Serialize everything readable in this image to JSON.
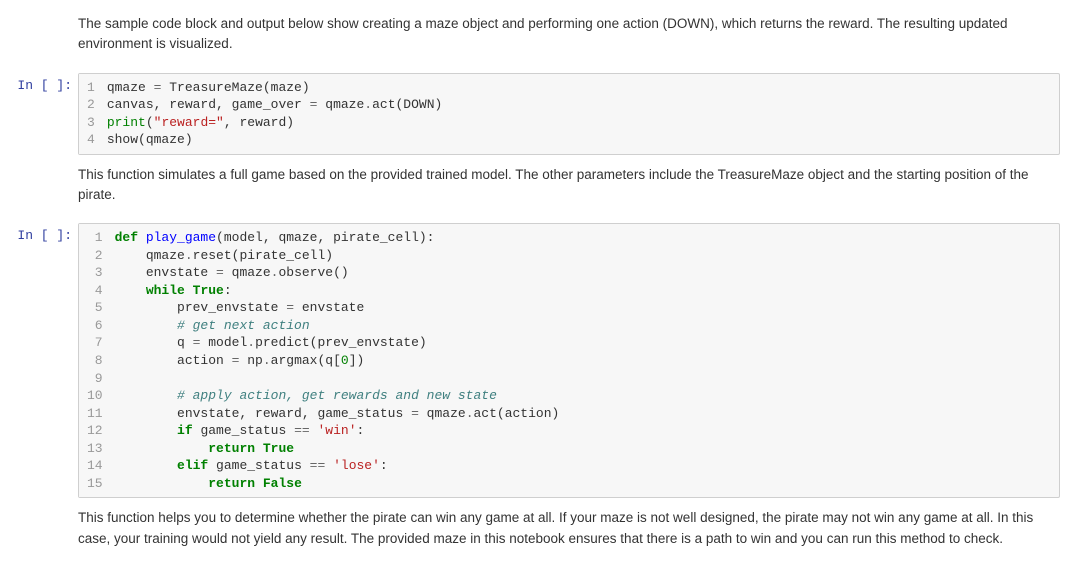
{
  "cells": {
    "md1": "The sample code block and output below show creating a maze object and performing one action (DOWN), which returns the reward. The resulting updated environment is visualized.",
    "md2": "This function simulates a full game based on the provided trained model. The other parameters include the TreasureMaze object and the starting position of the pirate.",
    "md3": "This function helps you to determine whether the pirate can win any game at all. If your maze is not well designed, the pirate may not win any game at all. In this case, your training would not yield any result. The provided maze in this notebook ensures that there is a path to win and you can run this method to check."
  },
  "prompts": {
    "in_empty": "In [ ]:"
  },
  "code1": {
    "l1a": "qmaze ",
    "l1b": "=",
    "l1c": " TreasureMaze(maze)",
    "l2a": "canvas, reward, game_over ",
    "l2b": "=",
    "l2c": " qmaze",
    "l2d": ".",
    "l2e": "act(DOWN)",
    "l3a": "print",
    "l3b": "(",
    "l3c": "\"reward=\"",
    "l3d": ", reward)",
    "l4a": "show(qmaze)"
  },
  "code2": {
    "l1a": "def",
    "l1b": " ",
    "l1c": "play_game",
    "l1d": "(model, qmaze, pirate_cell):",
    "l2a": "    qmaze",
    "l2b": ".",
    "l2c": "reset(pirate_cell)",
    "l3a": "    envstate ",
    "l3b": "=",
    "l3c": " qmaze",
    "l3d": ".",
    "l3e": "observe()",
    "l4a": "    ",
    "l4b": "while",
    "l4c": " ",
    "l4d": "True",
    "l4e": ":",
    "l5a": "        prev_envstate ",
    "l5b": "=",
    "l5c": " envstate",
    "l6a": "        ",
    "l6b": "# get next action",
    "l7a": "        q ",
    "l7b": "=",
    "l7c": " model",
    "l7d": ".",
    "l7e": "predict(prev_envstate)",
    "l8a": "        action ",
    "l8b": "=",
    "l8c": " np",
    "l8d": ".",
    "l8e": "argmax(q[",
    "l8f": "0",
    "l8g": "])",
    "l10a": "        ",
    "l10b": "# apply action, get rewards and new state",
    "l11a": "        envstate, reward, game_status ",
    "l11b": "=",
    "l11c": " qmaze",
    "l11d": ".",
    "l11e": "act(action)",
    "l12a": "        ",
    "l12b": "if",
    "l12c": " game_status ",
    "l12d": "==",
    "l12e": " ",
    "l12f": "'win'",
    "l12g": ":",
    "l13a": "            ",
    "l13b": "return",
    "l13c": " ",
    "l13d": "True",
    "l14a": "        ",
    "l14b": "elif",
    "l14c": " game_status ",
    "l14d": "==",
    "l14e": " ",
    "l14f": "'lose'",
    "l14g": ":",
    "l15a": "            ",
    "l15b": "return",
    "l15c": " ",
    "l15d": "False"
  },
  "gutter": {
    "n1": "1",
    "n2": "2",
    "n3": "3",
    "n4": "4",
    "n5": "5",
    "n6": "6",
    "n7": "7",
    "n8": "8",
    "n9": "9",
    "n10": "10",
    "n11": "11",
    "n12": "12",
    "n13": "13",
    "n14": "14",
    "n15": "15"
  }
}
